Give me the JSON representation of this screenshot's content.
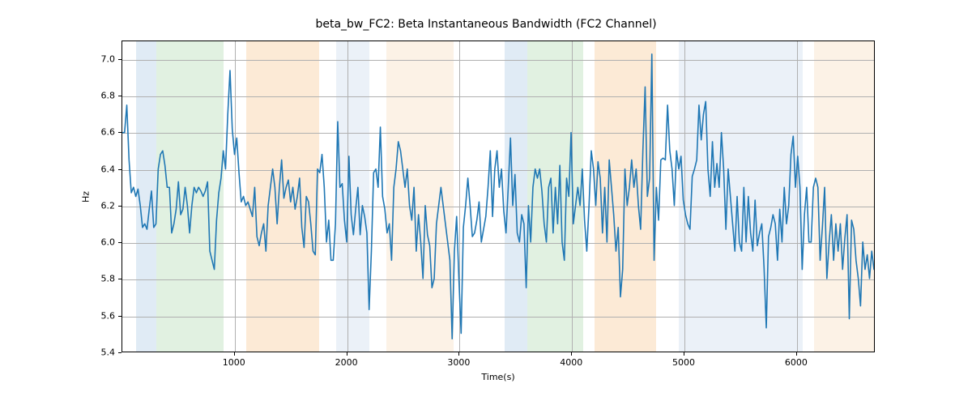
{
  "chart_data": {
    "type": "line",
    "title": "beta_bw_FC2: Beta Instantaneous Bandwidth (FC2 Channel)",
    "xlabel": "Time(s)",
    "ylabel": "Hz",
    "xlim": [
      0,
      6700
    ],
    "ylim": [
      5.4,
      7.1
    ],
    "xticks": [
      1000,
      2000,
      3000,
      4000,
      5000,
      6000
    ],
    "yticks": [
      5.4,
      5.6,
      5.8,
      6.0,
      6.2,
      6.4,
      6.6,
      6.8,
      7.0
    ],
    "line_color": "#1f77b4",
    "bands": [
      {
        "x0": 120,
        "x1": 300,
        "color": "#a7c5e3"
      },
      {
        "x0": 300,
        "x1": 900,
        "color": "#a8d8a8"
      },
      {
        "x0": 1100,
        "x1": 1750,
        "color": "#f7c38a"
      },
      {
        "x0": 1900,
        "x1": 2200,
        "color": "#c7d7ea"
      },
      {
        "x0": 2350,
        "x1": 2950,
        "color": "#f7d9b8"
      },
      {
        "x0": 3400,
        "x1": 3600,
        "color": "#a7c5e3"
      },
      {
        "x0": 3600,
        "x1": 4100,
        "color": "#a8d8a8"
      },
      {
        "x0": 4200,
        "x1": 4750,
        "color": "#f7c38a"
      },
      {
        "x0": 4950,
        "x1": 6050,
        "color": "#c7d7ea"
      },
      {
        "x0": 6150,
        "x1": 6700,
        "color": "#f7d9b8"
      }
    ],
    "x": [
      0,
      20,
      40,
      60,
      80,
      100,
      120,
      140,
      160,
      180,
      200,
      220,
      240,
      260,
      280,
      300,
      320,
      340,
      360,
      380,
      400,
      420,
      440,
      460,
      480,
      500,
      520,
      540,
      560,
      580,
      600,
      620,
      640,
      660,
      680,
      700,
      720,
      740,
      760,
      780,
      800,
      820,
      840,
      860,
      880,
      900,
      920,
      940,
      960,
      980,
      1000,
      1020,
      1040,
      1060,
      1080,
      1100,
      1120,
      1140,
      1160,
      1180,
      1200,
      1220,
      1240,
      1260,
      1280,
      1300,
      1320,
      1340,
      1360,
      1380,
      1400,
      1420,
      1440,
      1460,
      1480,
      1500,
      1520,
      1540,
      1560,
      1580,
      1600,
      1620,
      1640,
      1660,
      1680,
      1700,
      1720,
      1740,
      1760,
      1780,
      1800,
      1820,
      1840,
      1860,
      1880,
      1900,
      1920,
      1940,
      1960,
      1980,
      2000,
      2020,
      2040,
      2060,
      2080,
      2100,
      2120,
      2140,
      2160,
      2180,
      2200,
      2220,
      2240,
      2260,
      2280,
      2300,
      2320,
      2340,
      2360,
      2380,
      2400,
      2420,
      2440,
      2460,
      2480,
      2500,
      2520,
      2540,
      2560,
      2580,
      2600,
      2620,
      2640,
      2660,
      2680,
      2700,
      2720,
      2740,
      2760,
      2780,
      2800,
      2820,
      2840,
      2860,
      2880,
      2900,
      2920,
      2940,
      2960,
      2980,
      3000,
      3020,
      3040,
      3060,
      3080,
      3100,
      3120,
      3140,
      3160,
      3180,
      3200,
      3220,
      3240,
      3260,
      3280,
      3300,
      3320,
      3340,
      3360,
      3380,
      3400,
      3420,
      3440,
      3460,
      3480,
      3500,
      3520,
      3540,
      3560,
      3580,
      3600,
      3620,
      3640,
      3660,
      3680,
      3700,
      3720,
      3740,
      3760,
      3780,
      3800,
      3820,
      3840,
      3860,
      3880,
      3900,
      3920,
      3940,
      3960,
      3980,
      4000,
      4020,
      4040,
      4060,
      4080,
      4100,
      4120,
      4140,
      4160,
      4180,
      4200,
      4220,
      4240,
      4260,
      4280,
      4300,
      4320,
      4340,
      4360,
      4380,
      4400,
      4420,
      4440,
      4460,
      4480,
      4500,
      4520,
      4540,
      4560,
      4580,
      4600,
      4620,
      4640,
      4660,
      4680,
      4700,
      4720,
      4740,
      4760,
      4780,
      4800,
      4820,
      4840,
      4860,
      4880,
      4900,
      4920,
      4940,
      4960,
      4980,
      5000,
      5020,
      5040,
      5060,
      5080,
      5100,
      5120,
      5140,
      5160,
      5180,
      5200,
      5220,
      5240,
      5260,
      5280,
      5300,
      5320,
      5340,
      5360,
      5380,
      5400,
      5420,
      5440,
      5460,
      5480,
      5500,
      5520,
      5540,
      5560,
      5580,
      5600,
      5620,
      5640,
      5660,
      5680,
      5700,
      5720,
      5740,
      5760,
      5780,
      5800,
      5820,
      5840,
      5860,
      5880,
      5900,
      5920,
      5940,
      5960,
      5980,
      6000,
      6020,
      6040,
      6060,
      6080,
      6100,
      6120,
      6140,
      6160,
      6180,
      6200,
      6220,
      6240,
      6260,
      6280,
      6300,
      6320,
      6340,
      6360,
      6380,
      6400,
      6420,
      6440,
      6460,
      6480,
      6500,
      6520,
      6540,
      6560,
      6580,
      6600,
      6620,
      6640,
      6660,
      6680,
      6700
    ],
    "values": [
      6.6,
      6.6,
      6.75,
      6.45,
      6.27,
      6.3,
      6.25,
      6.29,
      6.2,
      6.08,
      6.1,
      6.07,
      6.18,
      6.28,
      6.08,
      6.1,
      6.4,
      6.48,
      6.5,
      6.42,
      6.3,
      6.3,
      6.05,
      6.1,
      6.18,
      6.33,
      6.15,
      6.18,
      6.3,
      6.2,
      6.05,
      6.2,
      6.3,
      6.27,
      6.3,
      6.28,
      6.25,
      6.28,
      6.33,
      5.95,
      5.9,
      5.85,
      6.12,
      6.27,
      6.35,
      6.5,
      6.4,
      6.7,
      6.94,
      6.62,
      6.48,
      6.57,
      6.38,
      6.22,
      6.25,
      6.2,
      6.22,
      6.18,
      6.14,
      6.3,
      6.03,
      5.98,
      6.05,
      6.1,
      5.95,
      6.2,
      6.3,
      6.4,
      6.3,
      6.1,
      6.3,
      6.45,
      6.24,
      6.3,
      6.34,
      6.22,
      6.3,
      6.18,
      6.25,
      6.35,
      6.08,
      5.97,
      6.25,
      6.22,
      6.1,
      5.95,
      5.93,
      6.4,
      6.38,
      6.48,
      6.3,
      6.0,
      6.12,
      5.9,
      5.9,
      6.1,
      6.66,
      6.3,
      6.32,
      6.12,
      6.0,
      6.47,
      6.15,
      6.04,
      6.18,
      6.3,
      6.04,
      6.2,
      6.14,
      6.05,
      5.63,
      5.95,
      6.38,
      6.4,
      6.3,
      6.63,
      6.25,
      6.18,
      6.05,
      6.1,
      5.9,
      6.3,
      6.4,
      6.55,
      6.5,
      6.4,
      6.3,
      6.4,
      6.2,
      6.12,
      6.3,
      5.95,
      6.15,
      6.0,
      5.8,
      6.2,
      6.04,
      5.98,
      5.75,
      5.8,
      6.1,
      6.2,
      6.3,
      6.2,
      6.1,
      6.0,
      5.9,
      5.47,
      5.95,
      6.14,
      5.8,
      5.5,
      6.08,
      6.2,
      6.35,
      6.2,
      6.03,
      6.05,
      6.12,
      6.22,
      6.0,
      6.07,
      6.14,
      6.3,
      6.5,
      6.14,
      6.4,
      6.5,
      6.3,
      6.4,
      6.17,
      6.05,
      6.3,
      6.57,
      6.2,
      6.37,
      6.05,
      6.0,
      6.15,
      6.1,
      5.75,
      6.2,
      6.0,
      6.3,
      6.4,
      6.35,
      6.4,
      6.28,
      6.1,
      6.0,
      6.3,
      6.35,
      6.05,
      6.3,
      6.1,
      6.42,
      6.0,
      5.9,
      6.35,
      6.25,
      6.6,
      6.1,
      6.2,
      6.3,
      6.2,
      6.4,
      6.12,
      5.95,
      6.2,
      6.5,
      6.4,
      6.2,
      6.44,
      6.35,
      6.05,
      6.3,
      6.0,
      6.45,
      6.3,
      6.15,
      5.95,
      6.08,
      5.7,
      5.85,
      6.4,
      6.2,
      6.3,
      6.45,
      6.3,
      6.4,
      6.2,
      6.07,
      6.5,
      6.85,
      6.25,
      6.35,
      7.03,
      5.9,
      6.3,
      6.12,
      6.45,
      6.46,
      6.45,
      6.75,
      6.5,
      6.4,
      6.2,
      6.5,
      6.4,
      6.47,
      6.23,
      6.15,
      6.1,
      6.07,
      6.36,
      6.4,
      6.45,
      6.75,
      6.56,
      6.7,
      6.77,
      6.4,
      6.25,
      6.55,
      6.3,
      6.43,
      6.3,
      6.6,
      6.4,
      6.07,
      6.4,
      6.25,
      6.1,
      5.95,
      6.25,
      6.0,
      5.95,
      6.3,
      6.0,
      6.25,
      6.05,
      5.95,
      6.23,
      5.98,
      6.05,
      6.1,
      5.86,
      5.53,
      6.03,
      6.08,
      6.15,
      6.1,
      5.9,
      6.18,
      6.0,
      6.3,
      6.1,
      6.2,
      6.48,
      6.58,
      6.3,
      6.47,
      6.3,
      5.85,
      6.15,
      6.3,
      6.0,
      6.0,
      6.3,
      6.35,
      6.3,
      5.9,
      6.08,
      6.3,
      5.8,
      6.0,
      6.15,
      5.9,
      6.1,
      5.95,
      6.1,
      5.85,
      6.02,
      6.15,
      5.58,
      6.12,
      6.07,
      5.9,
      5.8,
      5.65,
      6.0,
      5.85,
      5.93,
      5.8,
      5.95,
      5.85
    ]
  }
}
